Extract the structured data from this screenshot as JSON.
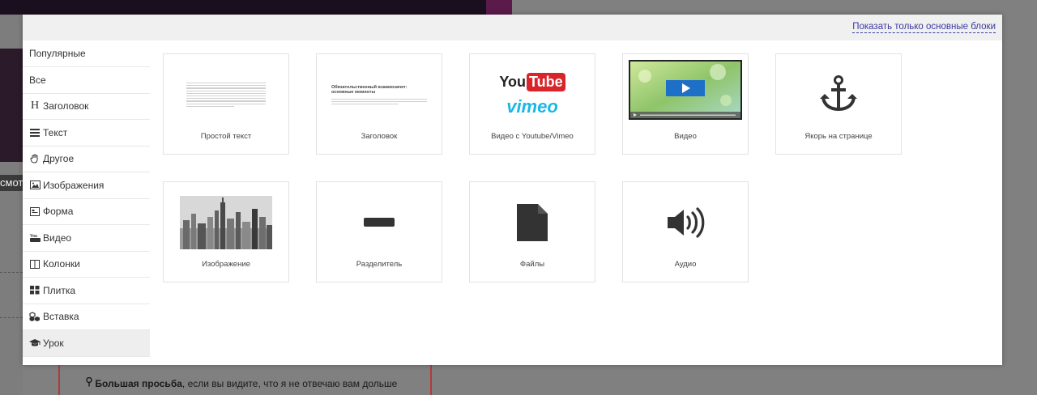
{
  "background": {
    "clipped_text": "смотр",
    "note_bold": "Большая просьба",
    "note_rest": ", если вы видите, что я не отвечаю вам дольше"
  },
  "header": {
    "show_basic_link": "Показать только основные блоки"
  },
  "sidebar": {
    "items": [
      {
        "label": "Популярные",
        "icon": ""
      },
      {
        "label": "Все",
        "icon": ""
      },
      {
        "label": "Заголовок",
        "icon": "heading-icon"
      },
      {
        "label": "Текст",
        "icon": "text-lines-icon"
      },
      {
        "label": "Другое",
        "icon": "hand-icon"
      },
      {
        "label": "Изображения",
        "icon": "image-icon"
      },
      {
        "label": "Форма",
        "icon": "form-icon"
      },
      {
        "label": "Видео",
        "icon": "youtube-icon"
      },
      {
        "label": "Колонки",
        "icon": "columns-icon"
      },
      {
        "label": "Плитка",
        "icon": "tiles-icon"
      },
      {
        "label": "Вставка",
        "icon": "cubes-icon"
      },
      {
        "label": "Урок",
        "icon": "graduation-cap-icon"
      }
    ],
    "active_item": "Урок"
  },
  "blocks": {
    "items": [
      {
        "label": "Простой текст"
      },
      {
        "label": "Заголовок",
        "preview_title": "Обязательственный взаимозачет: основные моменты"
      },
      {
        "label": "Видео с Youtube/Vimeo",
        "logo_top_you": "You",
        "logo_top_tube": "Tube",
        "logo_bottom": "vimeo"
      },
      {
        "label": "Видео"
      },
      {
        "label": "Якорь на странице"
      },
      {
        "label": "Изображение"
      },
      {
        "label": "Разделитель"
      },
      {
        "label": "Файлы"
      },
      {
        "label": "Аудио"
      }
    ]
  },
  "colors": {
    "link": "#3a3aa0",
    "youtube_red": "#d9252a",
    "vimeo_blue": "#1ab7ea",
    "icon_dark": "#333333"
  }
}
